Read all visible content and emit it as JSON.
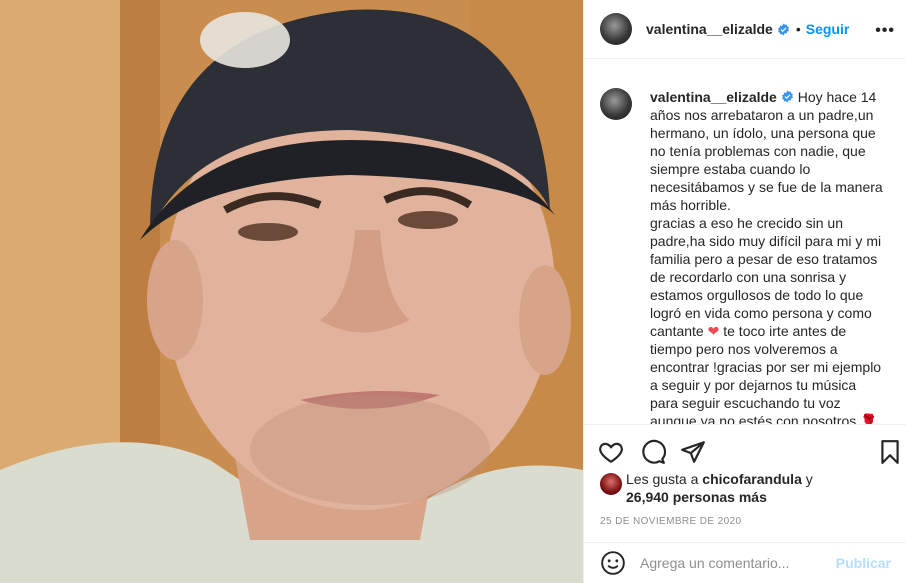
{
  "post": {
    "username": "valentina__elizalde",
    "separator": "•",
    "follow_label": "Seguir",
    "more_label": "•••",
    "caption": "Hoy hace 14 años nos arrebataron a un padre,un hermano, un ídolo, una persona que no tenía problemas con nadie, que siempre estaba cuando lo necesitábamos y se fue de la manera más horrible.\ngracias a eso he crecido sin un padre,ha sido muy difícil para mi y mi familia pero a pesar de eso tratamos de recordarlo con una sonrisa y estamos orgullosos de todo lo que logró en vida como persona y como cantante ❤️ te toco irte antes de tiempo pero nos volveremos a encontrar !gracias por ser mi ejemplo a seguir y por dejarnos tu música para seguir escuchando tu voz aunque ya no estés con nosotros 🌹",
    "heart_emoji": "❤️",
    "likes": {
      "prefix": "Les gusta a",
      "user": "chicofarandula",
      "conjunction": "y",
      "count_text": "26,940 personas más"
    },
    "date": "25 DE NOVIEMBRE DE 2020"
  },
  "comment": {
    "placeholder": "Agrega un comentario...",
    "publish_label": "Publicar"
  },
  "icons": {
    "verified": "verified-badge-icon",
    "like": "heart-outline-icon",
    "comment": "speech-bubble-icon",
    "share": "paper-plane-icon",
    "save": "bookmark-icon",
    "emoji": "smiley-icon"
  },
  "colors": {
    "accent": "#0095f6",
    "publish_disabled": "#b2dffc",
    "muted": "#8e8e8e",
    "text": "#262626"
  }
}
